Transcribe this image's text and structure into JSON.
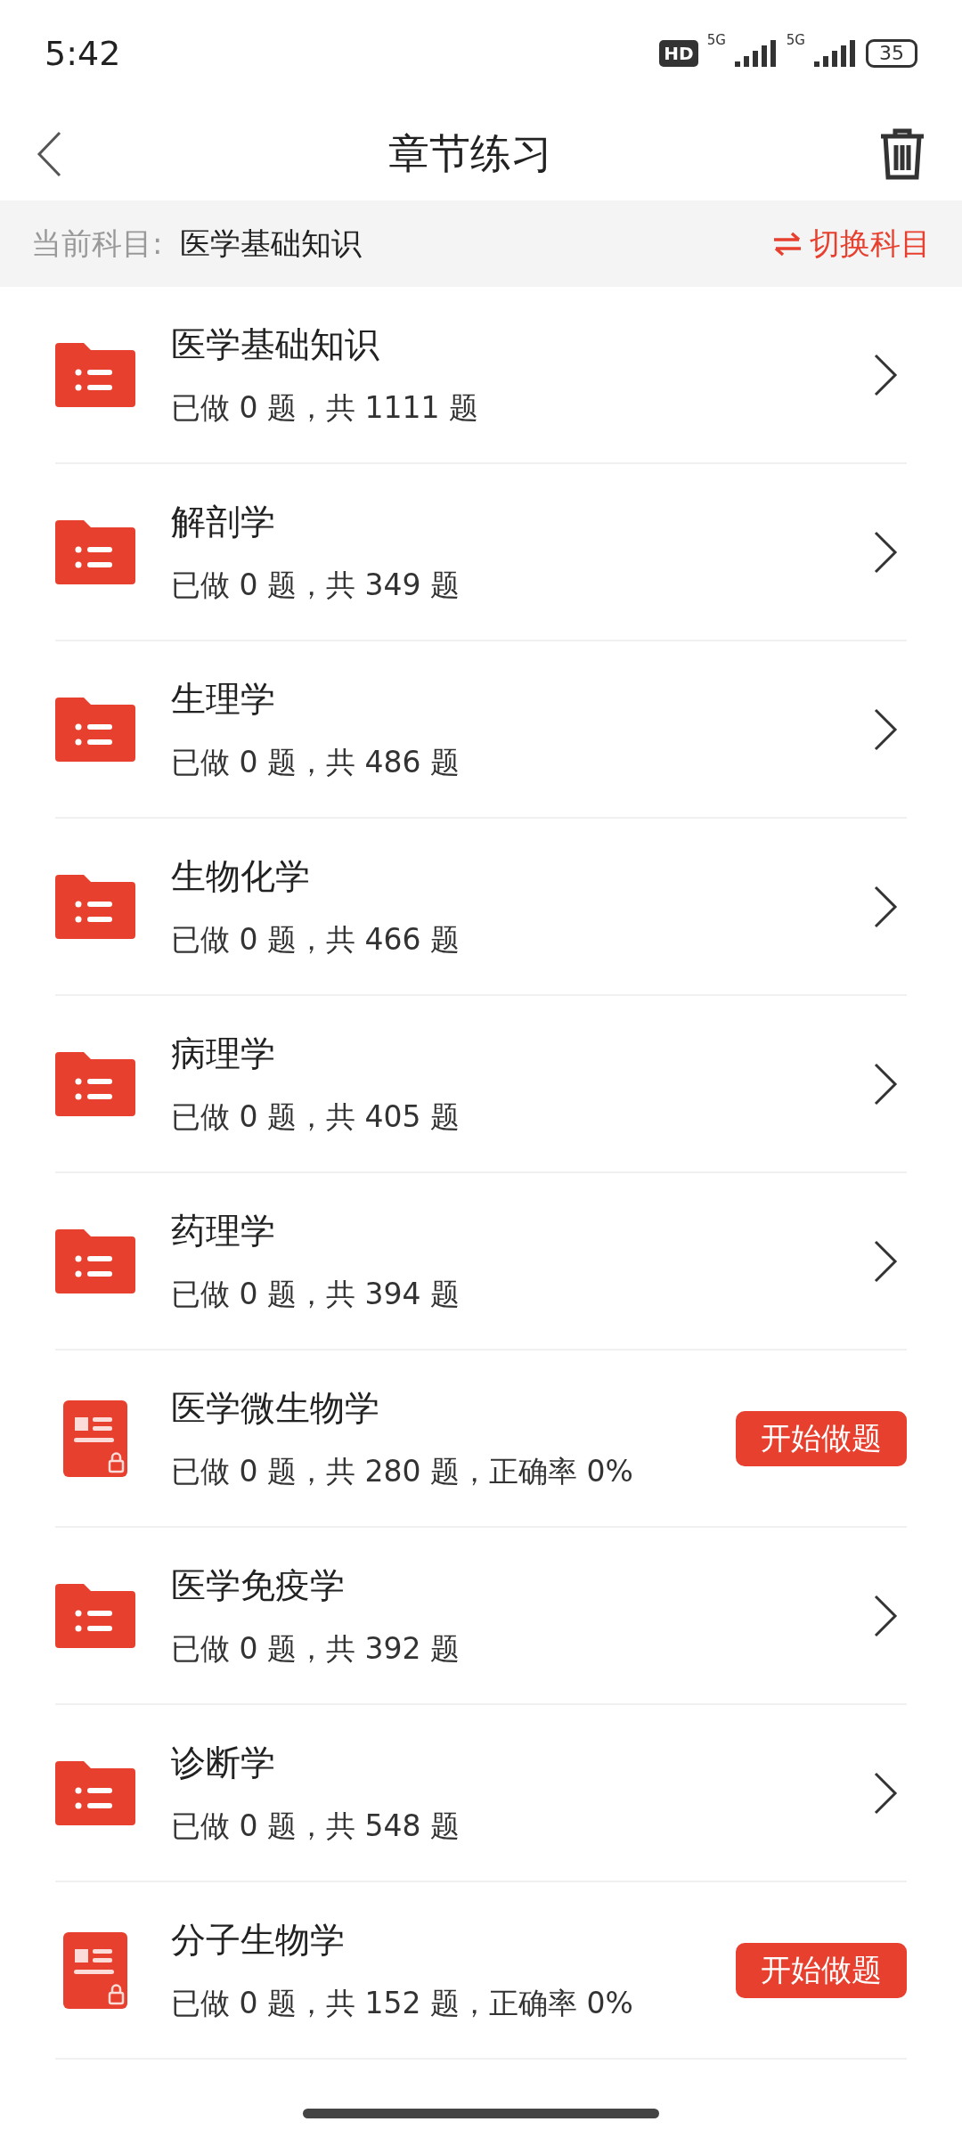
{
  "status_bar": {
    "time": "5:42",
    "hd_badge": "HD",
    "network_1": "5G",
    "network_2": "5G",
    "battery": "35"
  },
  "header": {
    "title": "章节练习"
  },
  "subject_bar": {
    "label": "当前科目:",
    "subject": "医学基础知识",
    "switch_link": "切换科目"
  },
  "chapters": [
    {
      "kind": "folder",
      "title": "医学基础知识",
      "progress": "已做 0 题，共 1111 题"
    },
    {
      "kind": "folder",
      "title": "解剖学",
      "progress": "已做 0 题，共 349 题"
    },
    {
      "kind": "folder",
      "title": "生理学",
      "progress": "已做 0 题，共 486 题"
    },
    {
      "kind": "folder",
      "title": "生物化学",
      "progress": "已做 0 题，共 466 题"
    },
    {
      "kind": "folder",
      "title": "病理学",
      "progress": "已做 0 题，共 405 题"
    },
    {
      "kind": "folder",
      "title": "药理学",
      "progress": "已做 0 题，共 394 题"
    },
    {
      "kind": "exercise",
      "title": "医学微生物学",
      "progress": "已做 0 题，共 280 题，正确率 0%",
      "button": "开始做题"
    },
    {
      "kind": "folder",
      "title": "医学免疫学",
      "progress": "已做 0 题，共 392 题"
    },
    {
      "kind": "folder",
      "title": "诊断学",
      "progress": "已做 0 题，共 548 题"
    },
    {
      "kind": "exercise",
      "title": "分子生物学",
      "progress": "已做 0 题，共 152 题，正确率 0%",
      "button": "开始做题"
    }
  ]
}
